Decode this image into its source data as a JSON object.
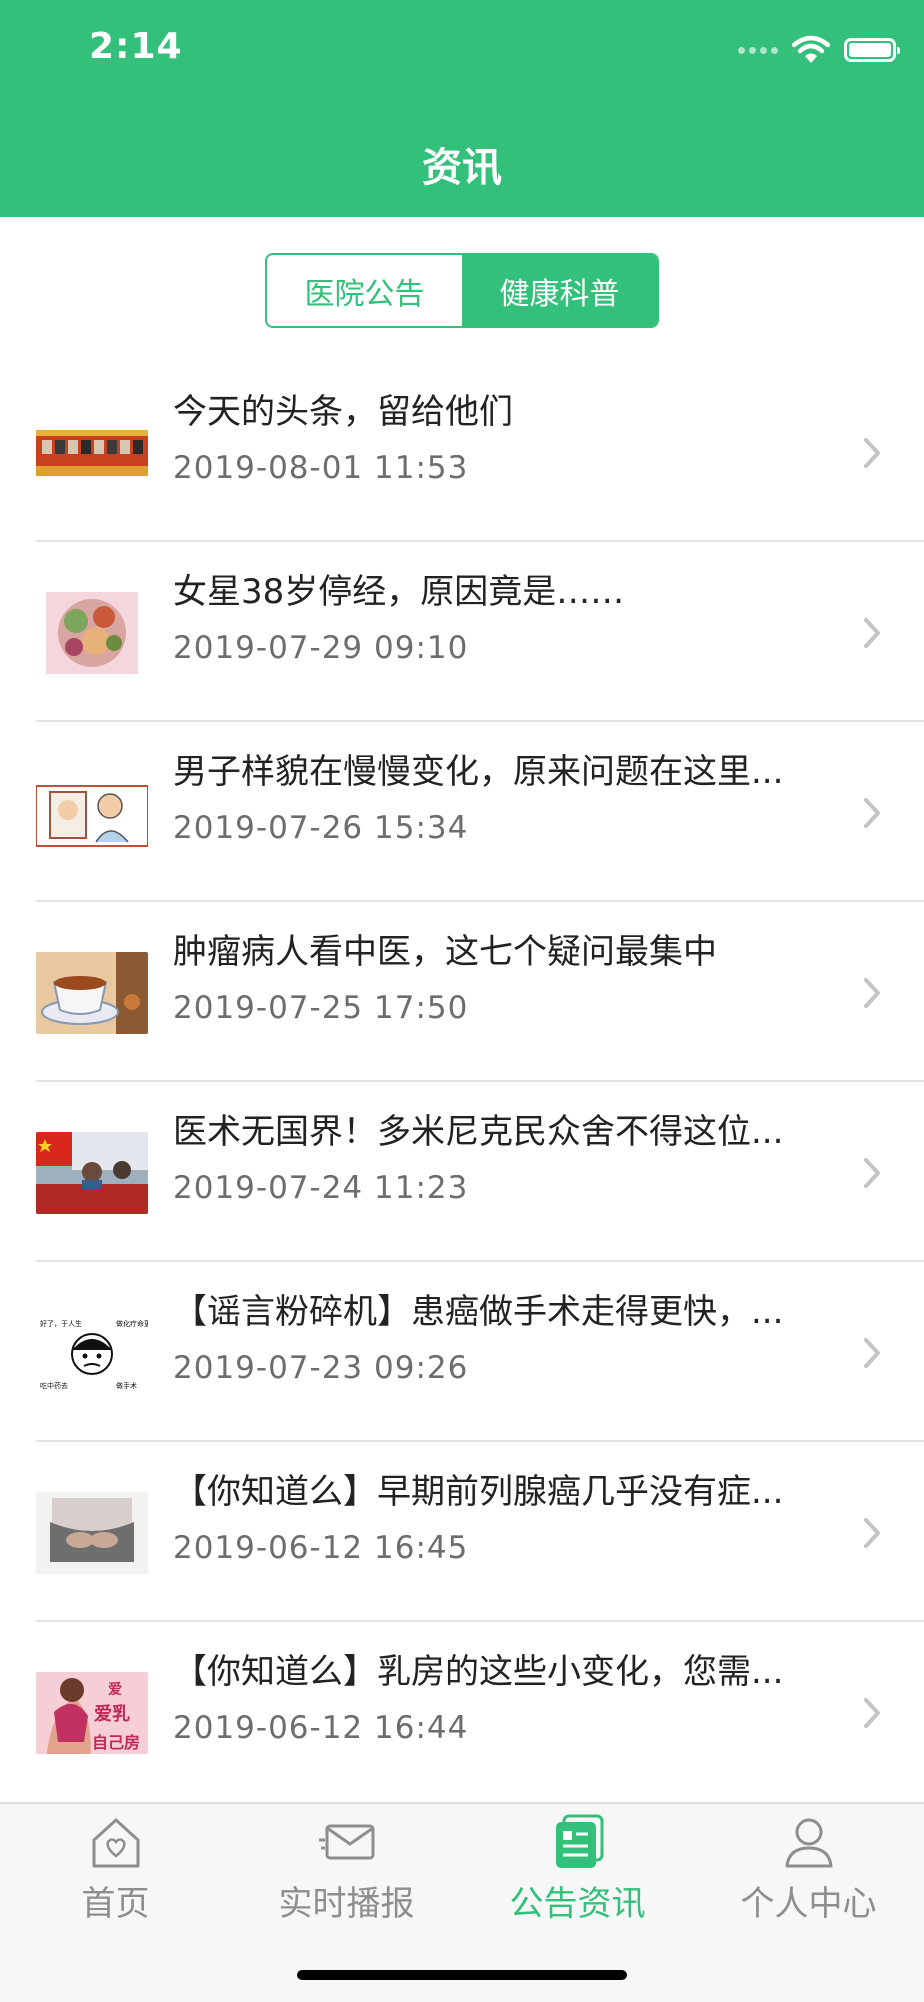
{
  "status_bar": {
    "time": "2:14"
  },
  "header": {
    "title": "资讯"
  },
  "segment": {
    "tabs": [
      {
        "label": "医院公告",
        "active": false
      },
      {
        "label": "健康科普",
        "active": true
      }
    ]
  },
  "articles": [
    {
      "title": "今天的头条，留给他们",
      "date": "2019-08-01 11:53"
    },
    {
      "title": "女星38岁停经，原因竟是……",
      "date": "2019-07-29 09:10"
    },
    {
      "title": "男子样貌在慢慢变化，原来问题在这里...",
      "date": "2019-07-26 15:34"
    },
    {
      "title": "肿瘤病人看中医，这七个疑问最集中",
      "date": "2019-07-25 17:50"
    },
    {
      "title": "医术无国界！多米尼克民众舍不得这位...",
      "date": "2019-07-24 11:23"
    },
    {
      "title": "【谣言粉碎机】患癌做手术走得更快，...",
      "date": "2019-07-23 09:26"
    },
    {
      "title": "【你知道么】早期前列腺癌几乎没有症...",
      "date": "2019-06-12 16:45"
    },
    {
      "title": "【你知道么】乳房的这些小变化，您需...",
      "date": "2019-06-12 16:44"
    }
  ],
  "thumb_text": {
    "rumor_top_left": "好了，于人生",
    "rumor_top_right": "做化疗命更长",
    "rumor_bottom_left": "吃中药去",
    "rumor_bottom_right": "做手术",
    "breast_line1": "爱",
    "breast_line2": "爱乳",
    "breast_line3": "自己房"
  },
  "tabbar": {
    "items": [
      {
        "label": "首页",
        "icon": "home-icon",
        "active": false
      },
      {
        "label": "实时播报",
        "icon": "envelope-icon",
        "active": false
      },
      {
        "label": "公告资讯",
        "icon": "news-icon",
        "active": true
      },
      {
        "label": "个人中心",
        "icon": "person-icon",
        "active": false
      }
    ]
  },
  "colors": {
    "accent": "#33c07a",
    "text": "#222222",
    "subtext": "#6d6d6d"
  }
}
